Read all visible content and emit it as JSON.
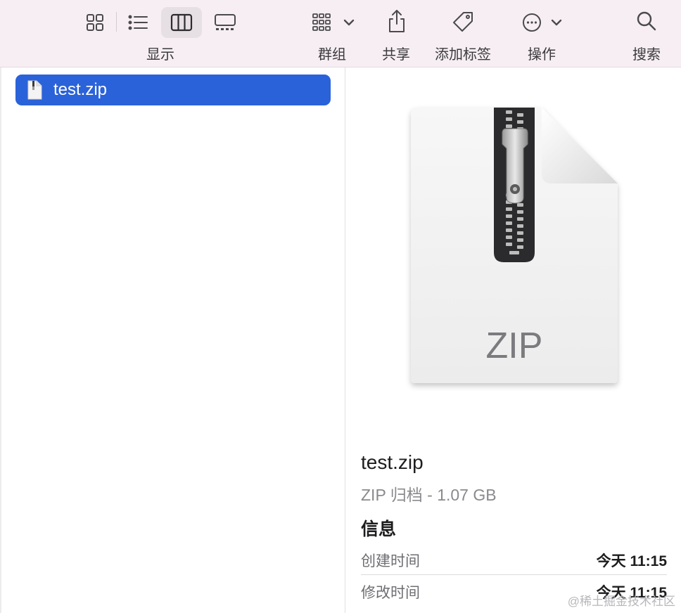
{
  "toolbar": {
    "view_label": "显示",
    "group_label": "群组",
    "share_label": "共享",
    "tags_label": "添加标签",
    "action_label": "操作",
    "search_label": "搜索"
  },
  "icons": {
    "view_icons": "grid-icon",
    "view_list": "list-icon",
    "view_columns": "columns-icon",
    "view_gallery": "gallery-icon",
    "group": "group-icon",
    "share": "share-icon",
    "tag": "tag-icon",
    "action": "ellipsis-circle-icon",
    "search": "magnifier-icon",
    "file": "zip-document-icon"
  },
  "file_list": {
    "items": [
      {
        "name": "test.zip",
        "selected": true
      }
    ]
  },
  "preview": {
    "badge": "ZIP",
    "file_name": "test.zip",
    "subtitle": "ZIP 归档 - 1.07 GB",
    "info_heading": "信息",
    "rows": [
      {
        "label": "创建时间",
        "value": "今天 11:15"
      },
      {
        "label": "修改时间",
        "value": "今天 11:15"
      }
    ]
  },
  "watermark": "@稀土掘金技术社区",
  "colors": {
    "selection": "#2a62d9",
    "toolbar_bg": "#f7eef3"
  }
}
